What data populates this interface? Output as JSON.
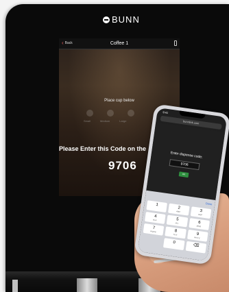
{
  "brand": {
    "name": "BUNN"
  },
  "kiosk": {
    "back_label": "Back",
    "title": "Coffee 1",
    "instruction": "Place cup below",
    "sizes": [
      "Small",
      "Medium",
      "Large"
    ],
    "code_prompt": "Please Enter this Code on the",
    "code": "9706"
  },
  "phone": {
    "time": "9:41",
    "url": "bunnlink.com",
    "prompt": "Enter dispense code:",
    "input_value": "9706",
    "submit_label": "OK",
    "done_label": "Done",
    "keys": [
      {
        "digit": "1",
        "letters": ""
      },
      {
        "digit": "2",
        "letters": "ABC"
      },
      {
        "digit": "3",
        "letters": "DEF"
      },
      {
        "digit": "4",
        "letters": "GHI"
      },
      {
        "digit": "5",
        "letters": "JKL"
      },
      {
        "digit": "6",
        "letters": "MNO"
      },
      {
        "digit": "7",
        "letters": "PQRS"
      },
      {
        "digit": "8",
        "letters": "TUV"
      },
      {
        "digit": "9",
        "letters": "WXYZ"
      },
      {
        "digit": "",
        "letters": ""
      },
      {
        "digit": "0",
        "letters": ""
      },
      {
        "digit": "⌫",
        "letters": ""
      }
    ]
  },
  "colors": {
    "accent_back": "#e05a5a",
    "submit_green": "#2f8f3f",
    "done_blue": "#2a67d9"
  }
}
